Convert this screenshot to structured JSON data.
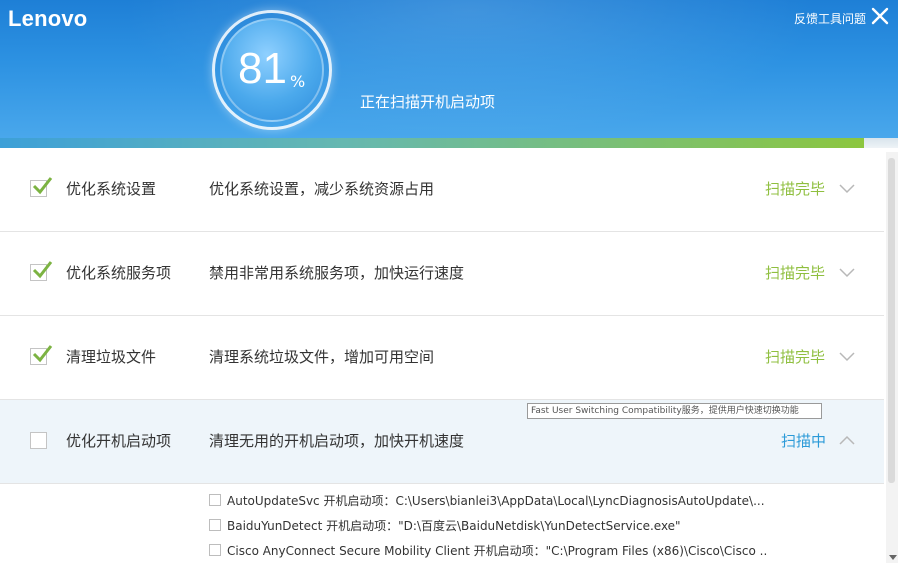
{
  "header": {
    "logo": "Lenovo",
    "feedback_label": "反馈工具问题",
    "close_icon": "close-icon",
    "progress_percent": "81",
    "progress_unit": "%",
    "status": "正在扫描开机启动项",
    "progress_bar_fraction": 0.962
  },
  "colors": {
    "header_blue": "#2d92e2",
    "done_green": "#8fbf3f",
    "scanning_blue": "#2b9ad8",
    "active_row_bg": "#eef5fa"
  },
  "rows": [
    {
      "name": "优化系统设置",
      "desc": "优化系统设置，减少系统资源占用",
      "status": "扫描完毕",
      "checked": true
    },
    {
      "name": "优化系统服务项",
      "desc": "禁用非常用系统服务项，加快运行速度",
      "status": "扫描完毕",
      "checked": true
    },
    {
      "name": "清理垃圾文件",
      "desc": "清理系统垃圾文件，增加可用空间",
      "status": "扫描完毕",
      "checked": true
    },
    {
      "name": "优化开机启动项",
      "desc": "清理无用的开机启动项，加快开机速度",
      "status": "扫描中",
      "checked": false
    }
  ],
  "tooltip": "Fast User Switching Compatibility服务，提供用户快速切换功能",
  "startup_items": [
    {
      "text": "AutoUpdateSvc 开机启动项：C:\\Users\\bianlei3\\AppData\\Local\\LyncDiagnosisAutoUpdate\\..."
    },
    {
      "text": "BaiduYunDetect 开机启动项：\"D:\\百度云\\BaiduNetdisk\\YunDetectService.exe\""
    },
    {
      "text": "Cisco AnyConnect Secure Mobility Client 开机启动项：\"C:\\Program Files (x86)\\Cisco\\Cisco ..."
    }
  ]
}
